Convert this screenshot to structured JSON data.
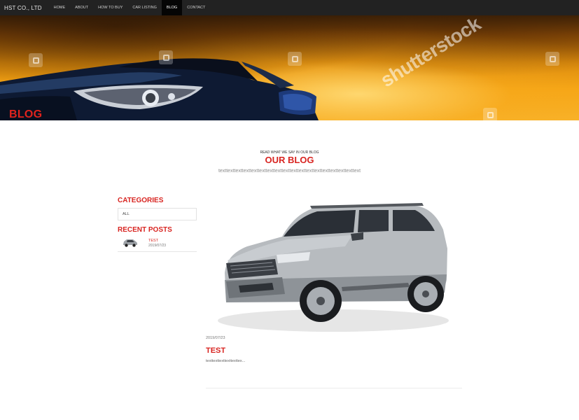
{
  "navbar": {
    "brand": "HST CO., LTD",
    "items": [
      {
        "label": "HOME"
      },
      {
        "label": "ABOUT"
      },
      {
        "label": "HOW TO BUY"
      },
      {
        "label": "CAR LISTING"
      },
      {
        "label": "BLOG"
      },
      {
        "label": "CONTACT"
      }
    ],
    "active": "BLOG"
  },
  "hero": {
    "title": "BLOG",
    "watermark": "shutterstock",
    "title_color": "#e0231d"
  },
  "section": {
    "kicker": "READ WHAT WE SAY IN OUR BLOG",
    "title": "OUR BLOG",
    "subtitle": "texttexttexttexttexttexttexttexttexttexttexttexttexttexttexttexttexttext"
  },
  "sidebar": {
    "categories_title": "CATEGORIES",
    "categories": [
      {
        "label": "ALL"
      }
    ],
    "recent_title": "RECENT POSTS",
    "recent_posts": [
      {
        "title": "TEST",
        "date": "2019/07/23",
        "thumbnail_icon": "suv-thumbnail"
      }
    ]
  },
  "post": {
    "image_icon": "silver-suv-image",
    "date": "2019/07/23",
    "title": "TEST",
    "excerpt": "texttexttexttexttexttex..."
  },
  "colors": {
    "accent": "#d82420",
    "navbar_bg": "#222222",
    "nav_active_bg": "#050505"
  }
}
